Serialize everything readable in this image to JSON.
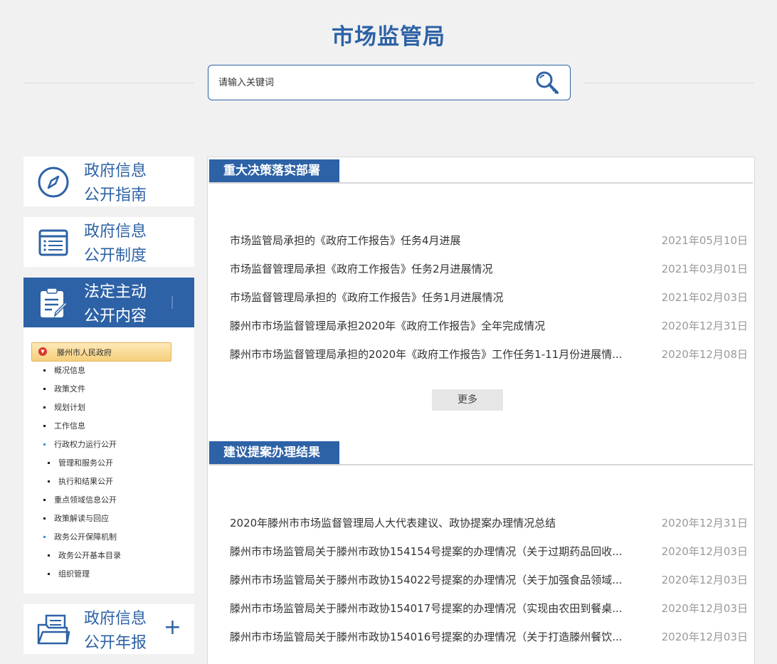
{
  "site": {
    "title": "市场监管局"
  },
  "search": {
    "placeholder": "请输入关键词"
  },
  "nav": {
    "guide": {
      "line1": "政府信息",
      "line2": "公开指南",
      "icon": "compass-icon"
    },
    "system": {
      "line1": "政府信息",
      "line2": "公开制度",
      "icon": "document-list-icon"
    },
    "statutory": {
      "line1": "法定主动",
      "line2": "公开内容",
      "icon": "clipboard-edit-icon"
    },
    "annual": {
      "line1": "政府信息",
      "line2": "公开年报",
      "icon": "folder-report-icon",
      "expand": "+"
    }
  },
  "tree": {
    "root": "滕州市人民政府",
    "items": [
      {
        "label": "概况信息"
      },
      {
        "label": "政策文件"
      },
      {
        "label": "规划计划"
      },
      {
        "label": "工作信息"
      },
      {
        "label": "行政权力运行公开"
      },
      {
        "label": "管理和服务公开"
      },
      {
        "label": "执行和结果公开"
      },
      {
        "label": "重点领域信息公开"
      },
      {
        "label": "政策解读与回应"
      },
      {
        "label": "政务公开保障机制"
      },
      {
        "label": "政务公开基本目录"
      },
      {
        "label": "组织管理"
      }
    ]
  },
  "sections": [
    {
      "title": "重大决策落实部署",
      "items": [
        {
          "title": "市场监管局承担的《政府工作报告》任务4月进展",
          "date": "2021年05月10日"
        },
        {
          "title": "市场监督管理局承担《政府工作报告》任务2月进展情况",
          "date": "2021年03月01日"
        },
        {
          "title": "市场监督管理局承担的《政府工作报告》任务1月进展情况",
          "date": "2021年02月03日"
        },
        {
          "title": "滕州市市场监督管理局承担2020年《政府工作报告》全年完成情况",
          "date": "2020年12月31日"
        },
        {
          "title": "滕州市市场监督管理局承担的2020年《政府工作报告》工作任务1-11月份进展情...",
          "date": "2020年12月08日"
        }
      ],
      "more": "更多"
    },
    {
      "title": "建议提案办理结果",
      "items": [
        {
          "title": "2020年滕州市市场监督管理局人大代表建议、政协提案办理情况总结",
          "date": "2020年12月31日"
        },
        {
          "title": "滕州市市场监管局关于滕州市政协154154号提案的办理情况（关于过期药品回收...",
          "date": "2020年12月03日"
        },
        {
          "title": "滕州市市场监管局关于滕州市政协154022号提案的办理情况（关于加强食品领域...",
          "date": "2020年12月03日"
        },
        {
          "title": "滕州市市场监管局关于滕州市政协154017号提案的办理情况（实现由农田到餐桌...",
          "date": "2020年12月03日"
        },
        {
          "title": "滕州市市场监管局关于滕州市政协154016号提案的办理情况（关于打造滕州餐饮...",
          "date": "2020年12月03日"
        }
      ]
    }
  ],
  "colors": {
    "brand": "#2d62a6",
    "background": "#f1f1f1",
    "date": "#999999"
  }
}
